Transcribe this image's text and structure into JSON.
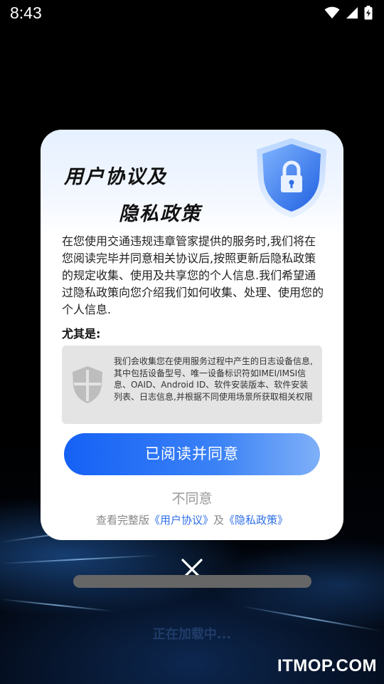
{
  "status_bar": {
    "time": "8:43",
    "icons": [
      "wifi-icon",
      "signal-icon",
      "battery-charging-icon"
    ]
  },
  "dialog": {
    "title_line1": "用户协议及",
    "title_line2": "隐私政策",
    "header_icon": "lock-shield-icon",
    "body": "在您使用交通违规违章管家提供的服务时,我们将在您阅读完毕并同意相关协议后,按照更新后隐私政策的规定收集、使用及共享您的个人信息.我们希望通过隐私政策向您介绍我们如何收集、处理、使用您的个人信息.",
    "subheading": "尤其是:",
    "notice_icon": "shield-icon",
    "notice_text": "我们会收集您在使用服务过程中产生的日志设备信息,其中包括设备型号、唯一设备标识符如IMEI/IMSI信息、OAID、Android ID、软件安装版本、软件安装列表、日志信息,并根据不同使用场景所获取相关权限",
    "agree_label": "已阅读并同意",
    "disagree_label": "不同意",
    "links": {
      "prefix": "查看完整版",
      "user_agreement": "《用户协议》",
      "conjunction": "及",
      "privacy_policy": "《隐私政策》"
    }
  },
  "overlay": {
    "close_icon": "close-icon",
    "loading_text": "正在加载中..."
  },
  "watermark": "ITMOP.COM",
  "colors": {
    "accent": "#1561f5",
    "link": "#2f6fe6",
    "loading_text": "#1f3c68"
  }
}
